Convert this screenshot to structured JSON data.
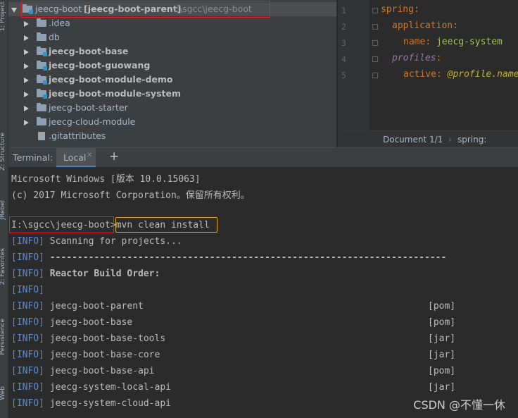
{
  "side_tabs": [
    "1: Project",
    "Z: Structure",
    "JRebel",
    "2: Favorites",
    "Persistence",
    "Web"
  ],
  "project_tree": {
    "root": {
      "name": "jeecg-boot",
      "module": "[jeecg-boot-parent]",
      "path": "I:\\sgcc\\jeecg-boot"
    },
    "items": [
      {
        "label": ".idea",
        "bold": false,
        "module": false
      },
      {
        "label": "db",
        "bold": false,
        "module": false
      },
      {
        "label": "jeecg-boot-base",
        "bold": true,
        "module": true
      },
      {
        "label": "jeecg-boot-guowang",
        "bold": true,
        "module": true
      },
      {
        "label": "jeecg-boot-module-demo",
        "bold": true,
        "module": true
      },
      {
        "label": "jeecg-boot-module-system",
        "bold": true,
        "module": true
      },
      {
        "label": "jeecg-boot-starter",
        "bold": false,
        "module": false
      },
      {
        "label": "jeecg-cloud-module",
        "bold": false,
        "module": false
      },
      {
        "label": ".gitattributes",
        "bold": false,
        "module": false
      }
    ]
  },
  "editor": {
    "line_numbers": [
      "1",
      "2",
      "3",
      "4",
      "5"
    ],
    "lines": [
      {
        "key": "spring",
        "value": ""
      },
      {
        "key": "application",
        "value": ""
      },
      {
        "key": "name",
        "value": "jeecg-system"
      },
      {
        "key": "profiles",
        "value": ""
      },
      {
        "key": "active",
        "value": "@profile.name"
      }
    ],
    "breadcrumb": {
      "doc": "Document 1/1",
      "path": "spring:"
    }
  },
  "terminal": {
    "label": "Terminal:",
    "tab": "Local",
    "add": "+",
    "header1": "Microsoft Windows [版本 10.0.15063]",
    "header2": "(c) 2017 Microsoft Corporation。保留所有权利。",
    "prompt": "I:\\sgcc\\jeecg-boot>",
    "command": "mvn clean install",
    "info_tag": "[INFO]",
    "scanning": "Scanning for projects...",
    "separator": "------------------------------------------------------------------------",
    "reactor": "Reactor Build Order:",
    "modules": [
      {
        "name": "jeecg-boot-parent",
        "pack": "[pom]"
      },
      {
        "name": "jeecg-boot-base",
        "pack": "[pom]"
      },
      {
        "name": "jeecg-boot-base-tools",
        "pack": "[jar]"
      },
      {
        "name": "jeecg-boot-base-core",
        "pack": "[jar]"
      },
      {
        "name": "jeecg-boot-base-api",
        "pack": "[pom]"
      },
      {
        "name": "jeecg-system-local-api",
        "pack": "[jar]"
      },
      {
        "name": "jeecg-system-cloud-api",
        "pack": ""
      }
    ]
  },
  "watermark": "CSDN @不懂一休"
}
